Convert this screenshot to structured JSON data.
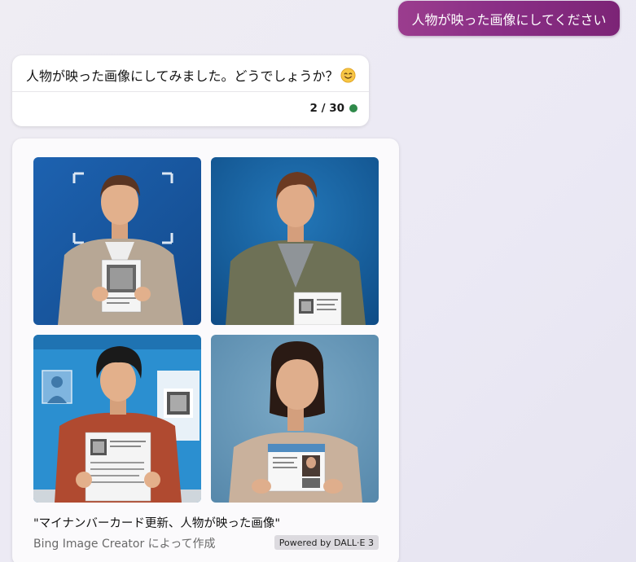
{
  "user_message": {
    "text": "人物が映った画像にしてください"
  },
  "assistant_reply": {
    "text": "人物が映った画像にしてみました。どうでしょうか？",
    "emoji": "smiling-face",
    "counter": "2 / 30",
    "status_color": "#2f8a4a"
  },
  "image_result": {
    "caption": "\"マイナンバーカード更新、人物が映った画像\"",
    "credit": "Bing Image Creator によって作成",
    "badge": "Powered by DALL·E 3",
    "images": [
      {
        "subject": "man-holding-document-with-qr-code",
        "background": "#1e5aa3"
      },
      {
        "subject": "man-holding-id-card-with-qr-code",
        "background": "#1a5f9e"
      },
      {
        "subject": "young-man-holding-form-with-qr-code",
        "background": "#2b8fd0"
      },
      {
        "subject": "woman-holding-id-card-with-photo",
        "background": "#6c9cbb"
      }
    ]
  }
}
